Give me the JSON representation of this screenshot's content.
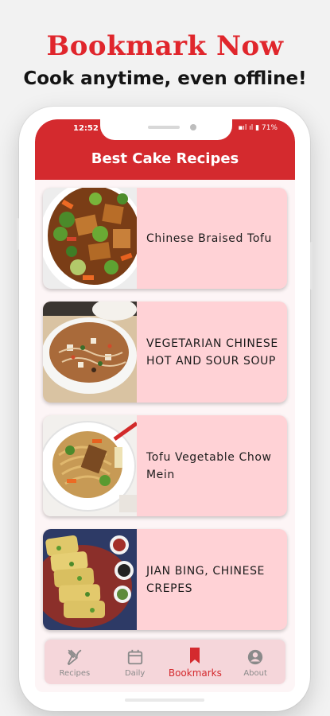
{
  "promo": {
    "title": "Bookmark Now",
    "subtitle": "Cook anytime, even offline!"
  },
  "status_bar": {
    "time": "12:52",
    "battery": "71%"
  },
  "app_bar": {
    "title": "Best Cake Recipes"
  },
  "recipes": [
    {
      "title": "Chinese Braised Tofu",
      "image": "braised-tofu-dish"
    },
    {
      "title": "VEGETARIAN CHINESE HOT AND SOUR SOUP",
      "image": "hot-and-sour-soup-bowl"
    },
    {
      "title": "Tofu Vegetable Chow Mein",
      "image": "chow-mein-plate"
    },
    {
      "title": "JIAN BING, CHINESE CREPES",
      "image": "jian-bing-crepes-plate"
    }
  ],
  "bottom_nav": {
    "items": [
      {
        "label": "Recipes",
        "icon": "fork-knife-icon"
      },
      {
        "label": "Daily",
        "icon": "calendar-icon"
      },
      {
        "label": "Bookmarks",
        "icon": "bookmark-icon",
        "active": true
      },
      {
        "label": "About",
        "icon": "account-icon"
      }
    ]
  },
  "colors": {
    "brand_red": "#d42a2e",
    "card_pink": "#ffd2d6",
    "nav_background": "#f5d6da"
  }
}
